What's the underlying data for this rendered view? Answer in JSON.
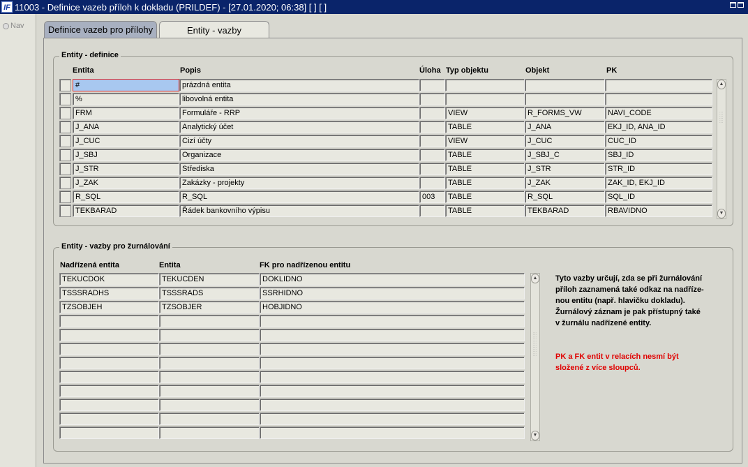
{
  "window": {
    "title": "11003 - Definice vazeb příloh k dokladu (PRILDEF) - [27.01.2020; 06:38]  [ ]  [ ]",
    "icon_text": "IF"
  },
  "nav": {
    "label": "Nav"
  },
  "tabs": [
    {
      "label": "Definice vazeb pro přílohy"
    },
    {
      "label": "Entity - vazby"
    }
  ],
  "entity_def": {
    "title": "Entity - definice",
    "headers": {
      "entita": "Entita",
      "popis": "Popis",
      "uloha": "Úloha",
      "typ": "Typ objektu",
      "objekt": "Objekt",
      "pk": "PK"
    },
    "rows": [
      {
        "entita": "#",
        "popis": "prázdná entita",
        "uloha": "",
        "typ": "",
        "objekt": "",
        "pk": ""
      },
      {
        "entita": "%",
        "popis": "libovolná entita",
        "uloha": "",
        "typ": "",
        "objekt": "",
        "pk": ""
      },
      {
        "entita": "FRM",
        "popis": "Formuláře - RRP",
        "uloha": "",
        "typ": "VIEW",
        "objekt": "R_FORMS_VW",
        "pk": "NAVI_CODE"
      },
      {
        "entita": "J_ANA",
        "popis": "Analytický účet",
        "uloha": "",
        "typ": "TABLE",
        "objekt": "J_ANA",
        "pk": "EKJ_ID, ANA_ID"
      },
      {
        "entita": "J_CUC",
        "popis": "Cizí účty",
        "uloha": "",
        "typ": "VIEW",
        "objekt": "J_CUC",
        "pk": "CUC_ID"
      },
      {
        "entita": "J_SBJ",
        "popis": "Organizace",
        "uloha": "",
        "typ": "TABLE",
        "objekt": "J_SBJ_C",
        "pk": "SBJ_ID"
      },
      {
        "entita": "J_STR",
        "popis": "Střediska",
        "uloha": "",
        "typ": "TABLE",
        "objekt": "J_STR",
        "pk": "STR_ID"
      },
      {
        "entita": "J_ZAK",
        "popis": "Zakázky - projekty",
        "uloha": "",
        "typ": "TABLE",
        "objekt": "J_ZAK",
        "pk": "ZAK_ID, EKJ_ID"
      },
      {
        "entita": "R_SQL",
        "popis": "R_SQL",
        "uloha": "003",
        "typ": "TABLE",
        "objekt": "R_SQL",
        "pk": "SQL_ID"
      },
      {
        "entita": "TEKBARAD",
        "popis": "Řádek bankovního výpisu",
        "uloha": "",
        "typ": "TABLE",
        "objekt": "TEKBARAD",
        "pk": "RBAVIDNO"
      }
    ]
  },
  "entity_links": {
    "title": "Entity - vazby pro žurnálování",
    "headers": {
      "parent": "Nadřízená entita",
      "entita": "Entita",
      "fk": "FK pro nadřízenou entitu"
    },
    "rows": [
      {
        "parent": "TEKUCDOK",
        "entita": "TEKUCDEN",
        "fk": "DOKLIDNO"
      },
      {
        "parent": "TSSSRADHS",
        "entita": "TSSSRADS",
        "fk": "SSRHIDNO"
      },
      {
        "parent": "TZSOBJEH",
        "entita": "TZSOBJER",
        "fk": "HOBJIDNO"
      },
      {
        "parent": "",
        "entita": "",
        "fk": ""
      },
      {
        "parent": "",
        "entita": "",
        "fk": ""
      },
      {
        "parent": "",
        "entita": "",
        "fk": ""
      },
      {
        "parent": "",
        "entita": "",
        "fk": ""
      },
      {
        "parent": "",
        "entita": "",
        "fk": ""
      },
      {
        "parent": "",
        "entita": "",
        "fk": ""
      },
      {
        "parent": "",
        "entita": "",
        "fk": ""
      },
      {
        "parent": "",
        "entita": "",
        "fk": ""
      },
      {
        "parent": "",
        "entita": "",
        "fk": ""
      }
    ],
    "info_lines": [
      "Tyto vazby určují, zda se při žurnálování",
      "příloh zaznamená také odkaz na nadříze-",
      "nou entitu (např. hlavičku dokladu).",
      "Žurnálový záznam je pak přístupný také",
      "v žurnálu nadřízené entity."
    ],
    "warning_lines": [
      "PK a FK entit v relacích nesmí být",
      "složené z více sloupců."
    ]
  }
}
